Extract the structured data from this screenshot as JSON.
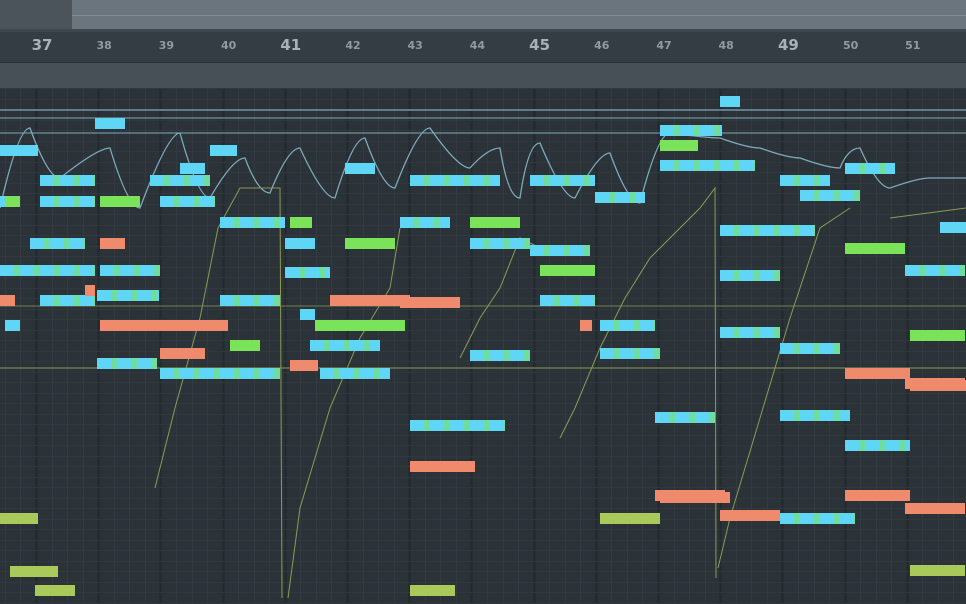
{
  "ruler": {
    "bars": [
      {
        "label": "37",
        "major": true
      },
      {
        "label": "38",
        "major": false
      },
      {
        "label": "39",
        "major": false
      },
      {
        "label": "40",
        "major": false
      },
      {
        "label": "41",
        "major": true
      },
      {
        "label": "42",
        "major": false
      },
      {
        "label": "43",
        "major": false
      },
      {
        "label": "44",
        "major": false
      },
      {
        "label": "45",
        "major": true
      },
      {
        "label": "46",
        "major": false
      },
      {
        "label": "47",
        "major": false
      },
      {
        "label": "48",
        "major": false
      },
      {
        "label": "49",
        "major": true
      },
      {
        "label": "50",
        "major": false
      },
      {
        "label": "51",
        "major": false
      }
    ]
  },
  "colors": {
    "background": "#2b3339",
    "note_cyan": "#5fd6f5",
    "note_green": "#7be35a",
    "note_yellowgreen": "#a9c95b",
    "note_orange": "#f08a6c",
    "automation_line": "#7fa9bb",
    "automation_olive": "#8c9a55"
  },
  "notes": [
    {
      "color": "cyan"
    },
    {
      "color": "cyan"
    },
    {
      "color": "cyan"
    },
    {
      "color": "cyan"
    },
    {
      "color": "cyan"
    },
    {
      "color": "cyan"
    },
    {
      "color": "cyan"
    },
    {
      "color": "green"
    },
    {
      "color": "cyan"
    },
    {
      "color": "green"
    },
    {
      "color": "cyan"
    },
    {
      "color": "cyan"
    },
    {
      "color": "green"
    },
    {
      "color": "cyan"
    },
    {
      "color": "orange"
    },
    {
      "color": "cyan"
    },
    {
      "color": "cyan"
    },
    {
      "color": "orange"
    },
    {
      "color": "cyan"
    },
    {
      "color": "orange"
    },
    {
      "color": "cyan"
    },
    {
      "color": "orange"
    },
    {
      "color": "cyan"
    },
    {
      "color": "orange"
    },
    {
      "color": "yellowgreen"
    },
    {
      "color": "yellowgreen"
    },
    {
      "color": "yellowgreen"
    },
    {
      "color": "cyan"
    },
    {
      "color": "cyan"
    },
    {
      "color": "green"
    },
    {
      "color": "cyan"
    },
    {
      "color": "cyan"
    },
    {
      "color": "cyan"
    },
    {
      "color": "cyan"
    },
    {
      "color": "green"
    },
    {
      "color": "cyan"
    },
    {
      "color": "orange"
    },
    {
      "color": "cyan"
    },
    {
      "color": "green"
    },
    {
      "color": "cyan"
    },
    {
      "color": "cyan"
    },
    {
      "color": "orange"
    },
    {
      "color": "cyan"
    },
    {
      "color": "orange"
    },
    {
      "color": "orange"
    },
    {
      "color": "cyan"
    },
    {
      "color": "cyan"
    },
    {
      "color": "orange"
    },
    {
      "color": "yellowgreen"
    },
    {
      "color": "cyan"
    },
    {
      "color": "cyan"
    },
    {
      "color": "cyan"
    },
    {
      "color": "green"
    },
    {
      "color": "cyan"
    },
    {
      "color": "cyan"
    },
    {
      "color": "cyan"
    },
    {
      "color": "green"
    },
    {
      "color": "cyan"
    },
    {
      "color": "orange"
    },
    {
      "color": "cyan"
    },
    {
      "color": "cyan"
    },
    {
      "color": "orange"
    },
    {
      "color": "yellowgreen"
    },
    {
      "color": "cyan"
    },
    {
      "color": "orange"
    },
    {
      "color": "cyan"
    },
    {
      "color": "cyan"
    },
    {
      "color": "green"
    },
    {
      "color": "cyan"
    },
    {
      "color": "cyan"
    },
    {
      "color": "cyan"
    },
    {
      "color": "orange"
    },
    {
      "color": "cyan"
    },
    {
      "color": "cyan"
    },
    {
      "color": "cyan"
    },
    {
      "color": "cyan"
    },
    {
      "color": "cyan"
    },
    {
      "color": "green"
    },
    {
      "color": "cyan"
    },
    {
      "color": "orange"
    },
    {
      "color": "orange"
    },
    {
      "color": "cyan"
    },
    {
      "color": "cyan"
    },
    {
      "color": "orange"
    },
    {
      "color": "yellowgreen"
    },
    {
      "color": "cyan"
    },
    {
      "color": "cyan"
    },
    {
      "color": "green"
    },
    {
      "color": "orange"
    },
    {
      "color": "orange"
    }
  ]
}
